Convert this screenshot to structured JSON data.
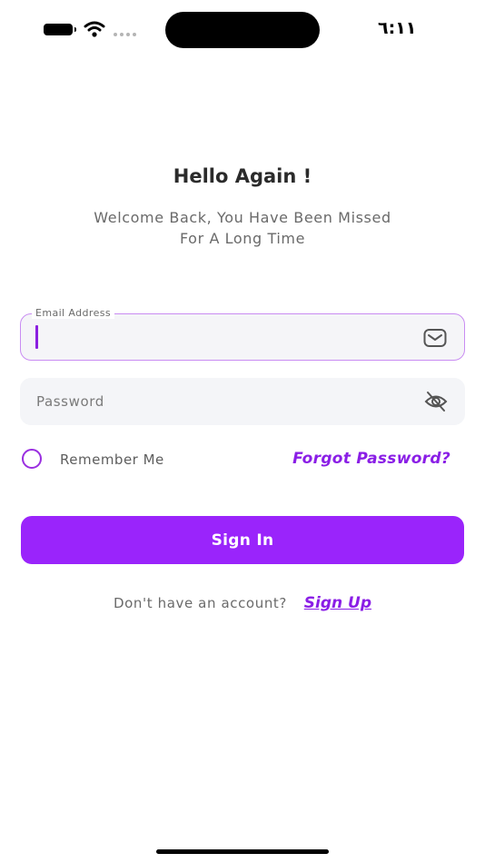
{
  "status_bar": {
    "time": "٦:١١",
    "battery_icon": "battery-icon",
    "wifi_icon": "wifi-icon"
  },
  "header": {
    "title": "Hello Again !",
    "subtitle_line1": "Welcome Back, You Have Been Missed",
    "subtitle_line2": "For A Long Time"
  },
  "form": {
    "email": {
      "label": "Email Address",
      "value": "",
      "icon": "mail-icon"
    },
    "password": {
      "placeholder": "Password",
      "value": "",
      "icon": "eye-off-icon"
    },
    "remember_label": "Remember Me",
    "forgot_label": "Forgot Password?",
    "signin_label": "Sign In"
  },
  "footer": {
    "prompt": "Don't have an account?",
    "signup_label": "Sign Up"
  },
  "colors": {
    "accent": "#9a24fb",
    "link": "#8a1ee6",
    "field_bg": "#f4f5f8",
    "focus_border": "#c98cf2"
  }
}
